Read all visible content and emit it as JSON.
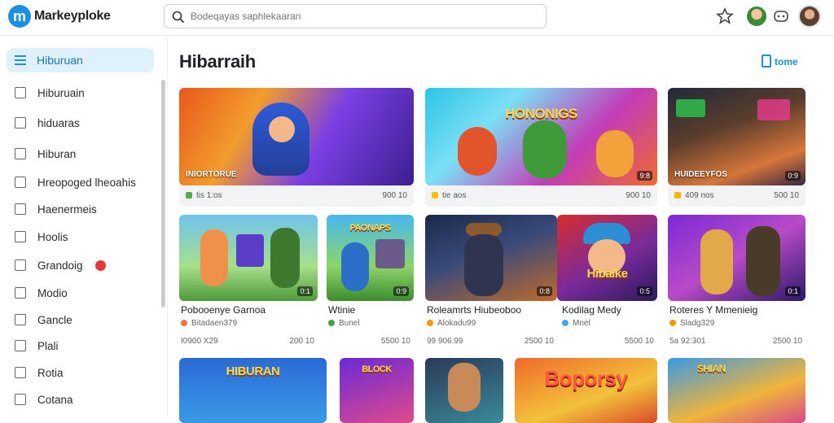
{
  "app": {
    "logo_letter": "m",
    "brand": "Markeyploke"
  },
  "search": {
    "placeholder": "Bodeqayas saphlekaaran"
  },
  "topbar_icons": [
    "star-icon",
    "avatar-character",
    "gamepad-icon",
    "user-avatar"
  ],
  "sidebar": {
    "active": {
      "label": "Hiburuan",
      "icon": "menu-icon"
    },
    "items": [
      {
        "label": "Hiburuain",
        "icon": "home-icon"
      },
      {
        "label": "hiduaras",
        "icon": "image-icon"
      },
      {
        "label": "Hiburan",
        "icon": "house-icon"
      },
      {
        "label": "Hreopoged lheoahis",
        "icon": "crop-icon"
      },
      {
        "label": "Haenermeis",
        "icon": "store-icon"
      },
      {
        "label": "Hoolis",
        "icon": "chart-icon"
      },
      {
        "label": "Grandoig",
        "icon": "gift-icon",
        "badge": ""
      },
      {
        "label": "Modio",
        "icon": "square-icon"
      },
      {
        "label": "Gancle",
        "icon": "box-icon"
      },
      {
        "label": "Plali",
        "icon": "doc-icon"
      },
      {
        "label": "Rotia",
        "icon": "shield-icon"
      },
      {
        "label": "Cotana",
        "icon": "mountain-icon"
      }
    ]
  },
  "main": {
    "title": "Hibarraih",
    "more_label": "tome",
    "featured": [
      {
        "label": "INIORTORUE",
        "bar_left": "tis 1:os",
        "bar_right": "900 10",
        "color": "#4caf50",
        "art": ""
      },
      {
        "label": "",
        "count": "9:8",
        "bar_left": "tie aos",
        "bar_right": "900 10",
        "color": "#ffc107",
        "art": "HONONIGS"
      },
      {
        "label": "HUIDEEYFOS",
        "count": "0:9",
        "bar_left": "409 nos",
        "bar_right": "500 10",
        "color": "#ffb300",
        "art": ""
      }
    ],
    "row2": [
      {
        "title": "Pobooenye Garnoa",
        "sub": "Bitadaen379",
        "foot_left": "I0900 X29",
        "foot_right": "200 10",
        "count": "0:1",
        "color": "#ff7043",
        "art": ""
      },
      {
        "title": "Wtinie",
        "sub": "Bunel",
        "foot_left": "",
        "foot_right": "5500 10",
        "count": "0:9",
        "color": "#43a047",
        "art": "PAONAPS"
      },
      {
        "title": "Roleamrts Hiubeoboo",
        "sub": "Alokadu99",
        "foot_left": "99 906:99",
        "foot_right": "2500 10",
        "count": "0:8",
        "color": "#ff9800",
        "art": ""
      },
      {
        "title": "Kodilag Medy",
        "sub": "Mnel",
        "foot_left": "",
        "foot_right": "5500 10",
        "count": "0:5",
        "color": "#42a5f5",
        "art": "Hibalke"
      },
      {
        "title": "Roteres Y Mmenieig",
        "sub": "Sladg329",
        "foot_left": "5a 92:301",
        "foot_right": "2500 10",
        "count": "0:1",
        "color": "#ff9800",
        "art": ""
      }
    ],
    "row3": [
      {
        "art": "HIBURAN"
      },
      {
        "art": "BLOCK"
      },
      {
        "art": ""
      },
      {
        "art": "Boporsy"
      },
      {
        "art": "SHIAN"
      }
    ]
  }
}
